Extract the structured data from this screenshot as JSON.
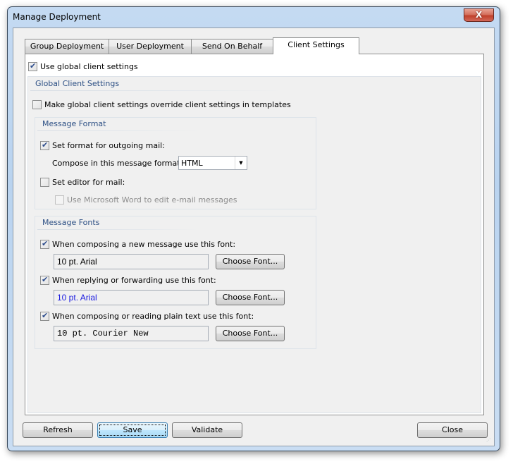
{
  "window": {
    "title": "Manage Deployment",
    "close_glyph": "X"
  },
  "tabs": [
    {
      "label": "Group Deployment",
      "active": false
    },
    {
      "label": "User Deployment",
      "active": false
    },
    {
      "label": "Send On Behalf",
      "active": false
    },
    {
      "label": "Client Settings",
      "active": true
    }
  ],
  "client_settings": {
    "use_global": {
      "label": "Use global client settings",
      "checked": true
    },
    "global_group": {
      "title": "Global Client Settings",
      "override": {
        "label": "Make global client settings override client settings in templates",
        "checked": false
      },
      "message_format": {
        "title": "Message Format",
        "set_format": {
          "label": "Set format for outgoing mail:",
          "checked": true
        },
        "compose_label": "Compose in this message format:",
        "compose_value": "HTML",
        "set_editor": {
          "label": "Set editor for mail:",
          "checked": false
        },
        "use_word": {
          "label": "Use Microsoft Word to edit e-mail messages",
          "checked": false,
          "disabled": true
        }
      },
      "message_fonts": {
        "title": "Message Fonts",
        "items": [
          {
            "label": "When composing a new message use this font:",
            "checked": true,
            "font": "10 pt. Arial",
            "button": "Choose Font..."
          },
          {
            "label": "When replying or forwarding use this font:",
            "checked": true,
            "font": "10 pt. Arial",
            "button": "Choose Font..."
          },
          {
            "label": "When composing or reading plain text use this font:",
            "checked": true,
            "font": "10 pt. Courier New",
            "button": "Choose Font..."
          }
        ]
      }
    }
  },
  "footer": {
    "refresh": "Refresh",
    "save": "Save",
    "validate": "Validate",
    "close": "Close"
  }
}
